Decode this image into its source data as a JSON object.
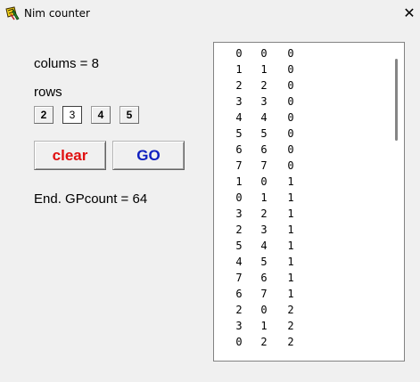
{
  "window": {
    "title": "Nim counter",
    "close_glyph": "✕"
  },
  "panel": {
    "columns_text": "colums = 8",
    "rows_label": "rows",
    "row_buttons": [
      "2",
      "3",
      "4",
      "5"
    ],
    "selected_row": "3",
    "clear_label": "clear",
    "go_label": "GO",
    "status_text": "End. GPcount = 64"
  },
  "colors": {
    "clear_text": "#e01010",
    "go_text": "#1020c0"
  },
  "list": {
    "rows": [
      [
        "0",
        "0",
        "0"
      ],
      [
        "1",
        "1",
        "0"
      ],
      [
        "2",
        "2",
        "0"
      ],
      [
        "3",
        "3",
        "0"
      ],
      [
        "4",
        "4",
        "0"
      ],
      [
        "5",
        "5",
        "0"
      ],
      [
        "6",
        "6",
        "0"
      ],
      [
        "7",
        "7",
        "0"
      ],
      [
        "1",
        "0",
        "1"
      ],
      [
        "0",
        "1",
        "1"
      ],
      [
        "3",
        "2",
        "1"
      ],
      [
        "2",
        "3",
        "1"
      ],
      [
        "5",
        "4",
        "1"
      ],
      [
        "4",
        "5",
        "1"
      ],
      [
        "7",
        "6",
        "1"
      ],
      [
        "6",
        "7",
        "1"
      ],
      [
        "2",
        "0",
        "2"
      ],
      [
        "3",
        "1",
        "2"
      ],
      [
        "0",
        "2",
        "2"
      ]
    ]
  }
}
